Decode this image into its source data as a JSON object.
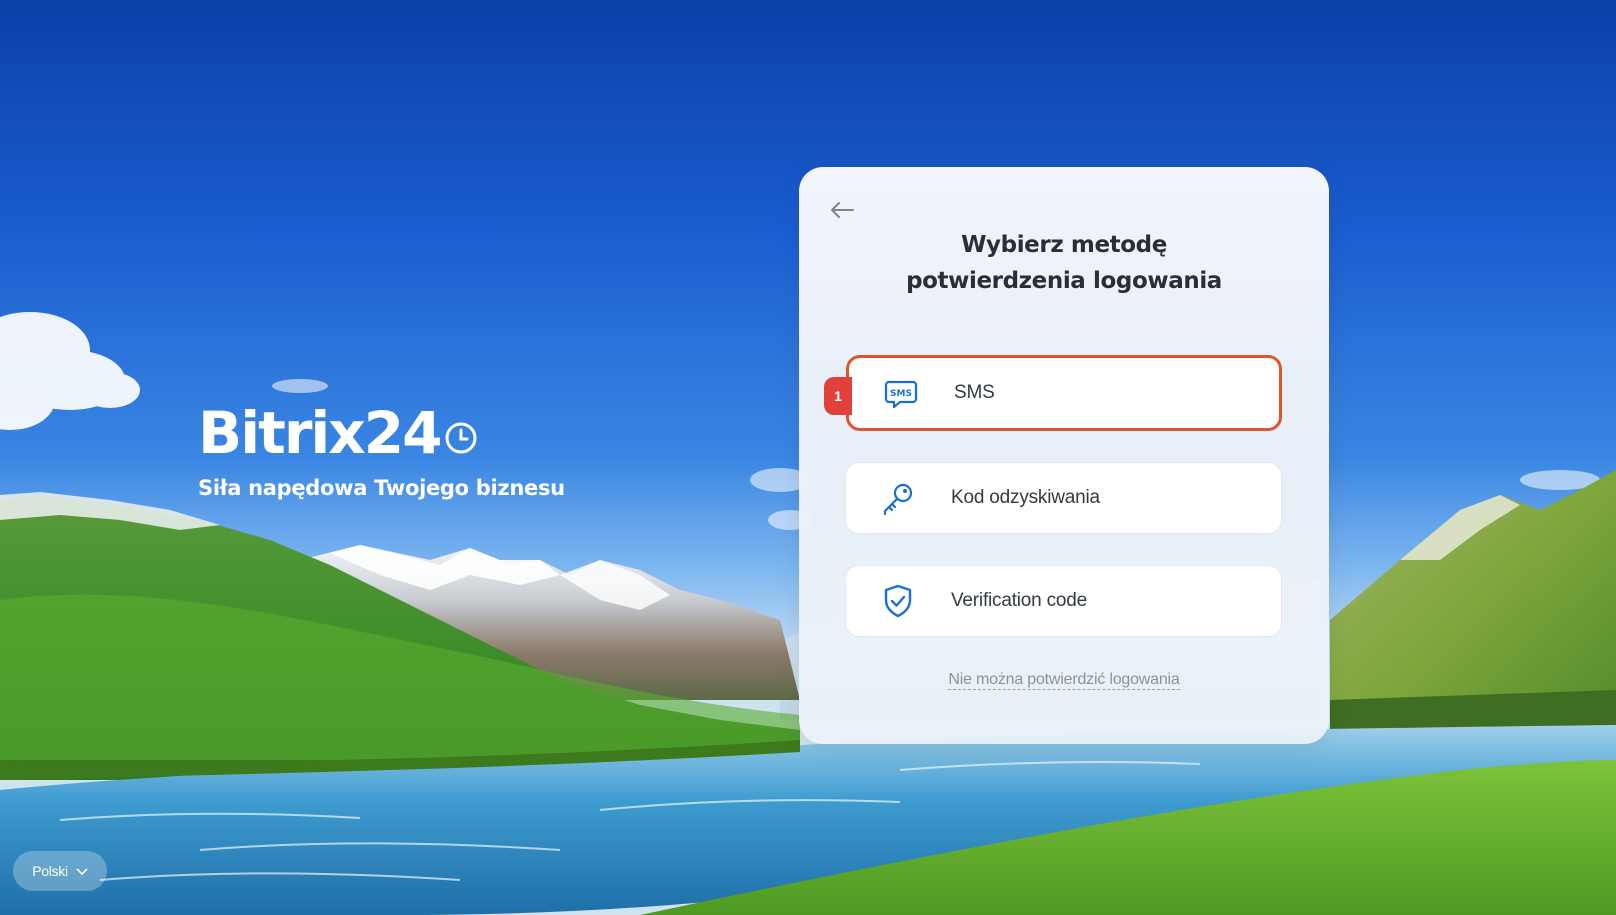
{
  "brand": {
    "logo_text": "Bitrix24",
    "tagline": "Siła napędowa Twojego biznesu"
  },
  "language": {
    "selected": "Polski"
  },
  "dialog": {
    "title_line1": "Wybierz metodę",
    "title_line2": "potwierdzenia logowania",
    "options": [
      {
        "label": "SMS",
        "icon": "sms-icon",
        "selected": true
      },
      {
        "label": "Kod odzyskiwania",
        "icon": "key-icon",
        "selected": false
      },
      {
        "label": "Verification code",
        "icon": "shield-check-icon",
        "selected": false
      }
    ],
    "cant_confirm_link": "Nie można potwierdzić logowania"
  },
  "annotation": {
    "step_number": "1",
    "highlight_color": "#e0542c",
    "badge_color": "#e0413a"
  },
  "colors": {
    "accent_blue": "#1a6fd6",
    "title_text": "#2b2f35"
  }
}
